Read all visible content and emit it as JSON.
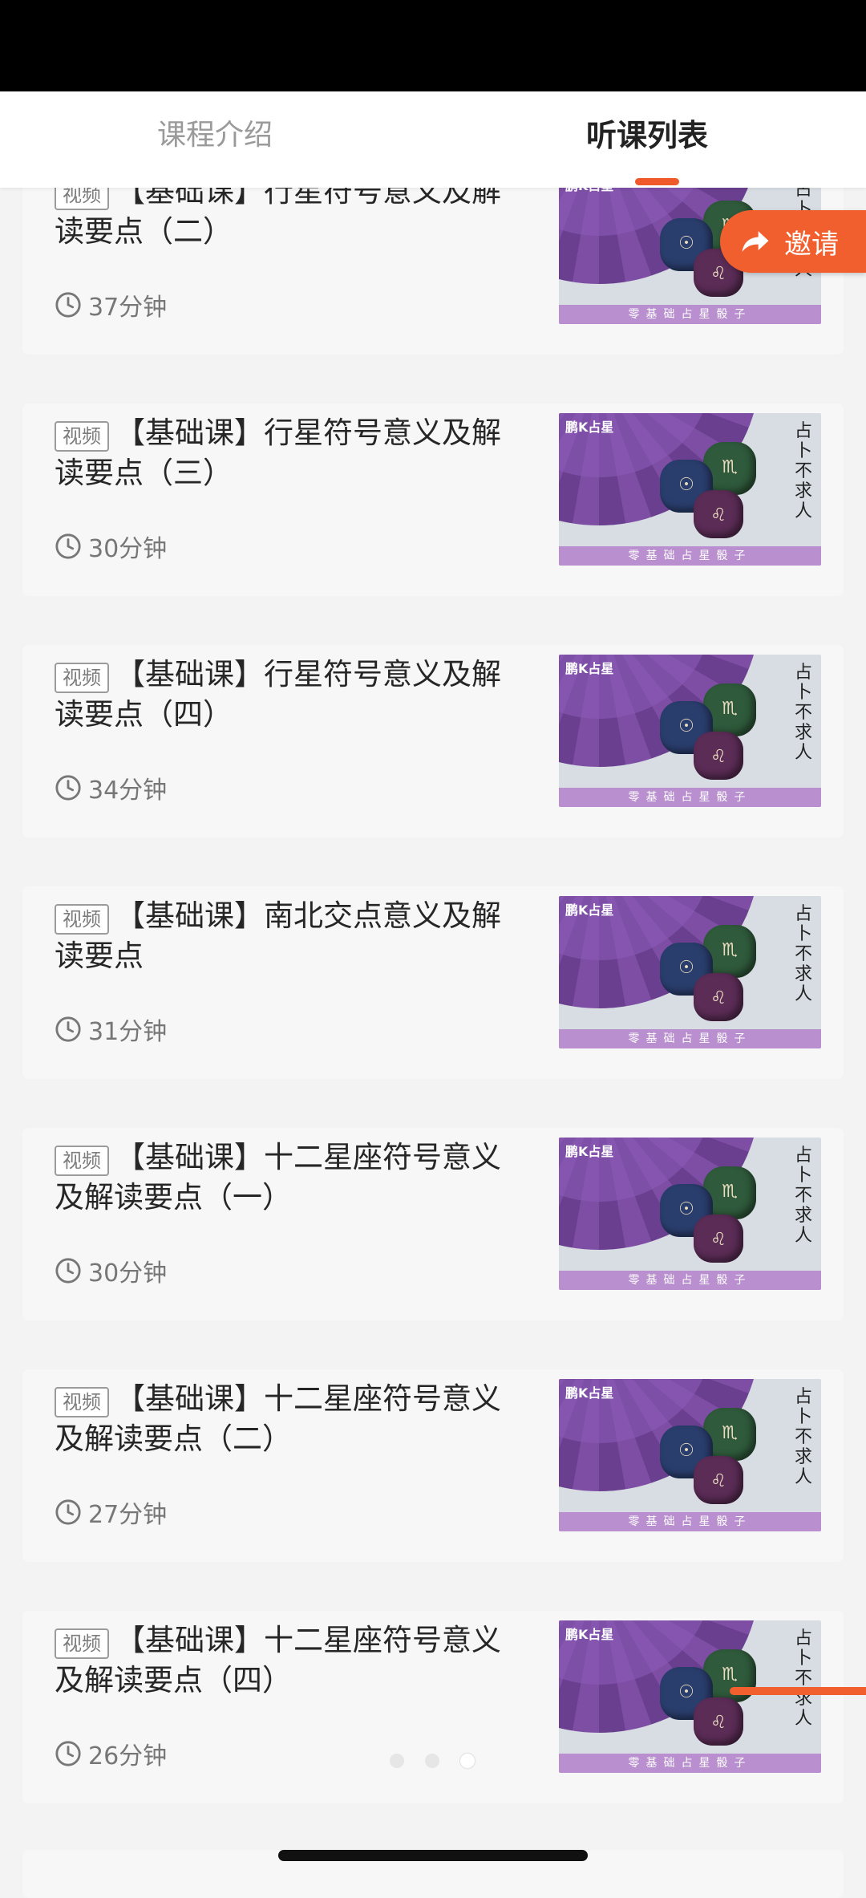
{
  "tabs": [
    {
      "label": "课程介绍",
      "active": false
    },
    {
      "label": "听课列表",
      "active": true
    }
  ],
  "invite_button": {
    "label": "邀请",
    "icon": "share-arrow-icon"
  },
  "badge_label": "视频",
  "thumbnail": {
    "logo": "鹏K占星",
    "side_text": "占卜不求人",
    "strip_text": "零基础占星骰子"
  },
  "lessons": [
    {
      "title": "【基础课】行星符号意义及解读要点（二）",
      "duration": "37分钟"
    },
    {
      "title": "【基础课】行星符号意义及解读要点（三）",
      "duration": "30分钟"
    },
    {
      "title": "【基础课】行星符号意义及解读要点（四）",
      "duration": "34分钟"
    },
    {
      "title": "【基础课】南北交点意义及解读要点",
      "duration": "31分钟"
    },
    {
      "title": "【基础课】十二星座符号意义及解读要点（一）",
      "duration": "30分钟"
    },
    {
      "title": "【基础课】十二星座符号意义及解读要点（二）",
      "duration": "27分钟"
    },
    {
      "title": "【基础课】十二星座符号意义及解读要点（四）",
      "duration": "26分钟"
    }
  ],
  "pager": {
    "count": 3,
    "active_index": 2
  },
  "colors": {
    "accent": "#f15f2e",
    "thumb_purple": "#7e4ea5"
  }
}
